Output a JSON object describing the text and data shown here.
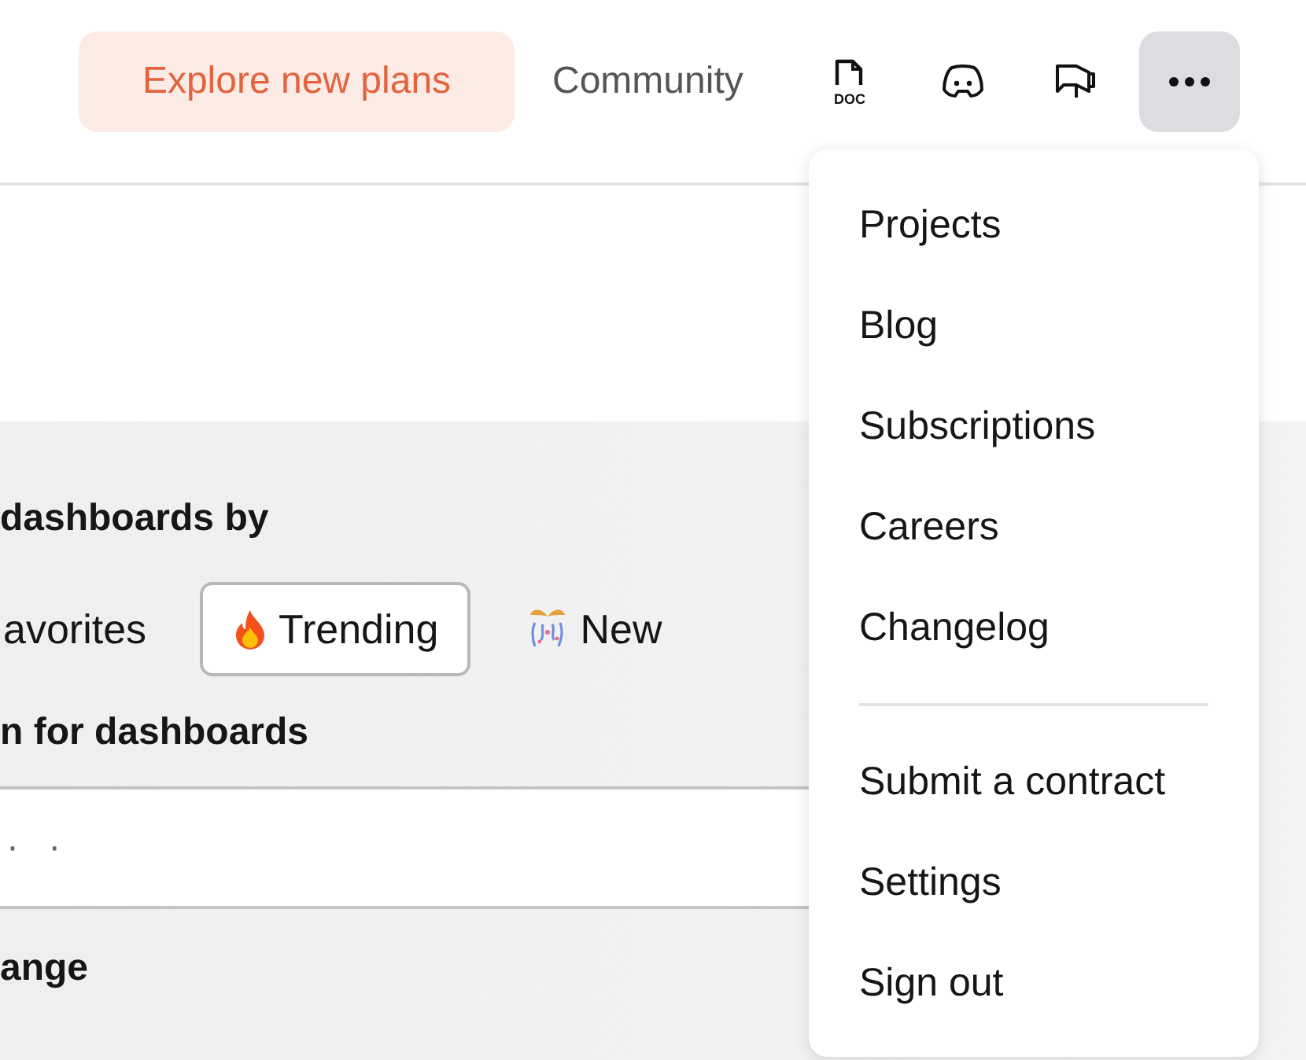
{
  "header": {
    "plans_button": "Explore new plans",
    "community_link": "Community",
    "icon_buttons": [
      {
        "kind": "doc",
        "label": "DOC"
      },
      {
        "kind": "chat"
      },
      {
        "kind": "megaphone"
      },
      {
        "kind": "more",
        "expanded": true
      }
    ]
  },
  "menu": {
    "sections": [
      {
        "items": [
          "Projects",
          "Blog",
          "Subscriptions",
          "Careers",
          "Changelog"
        ]
      },
      {
        "items": [
          "Submit a contract",
          "Settings",
          "Sign out"
        ]
      }
    ]
  },
  "filter": {
    "heading": "dashboards by",
    "options": [
      {
        "kind": "plain",
        "label": "avorites",
        "selected": false
      },
      {
        "kind": "trending",
        "label": "Trending",
        "selected": true
      },
      {
        "kind": "new",
        "label": "New",
        "selected": false
      }
    ]
  },
  "search": {
    "label": "n for dashboards",
    "placeholder": "· ·"
  },
  "range_label": "ange"
}
